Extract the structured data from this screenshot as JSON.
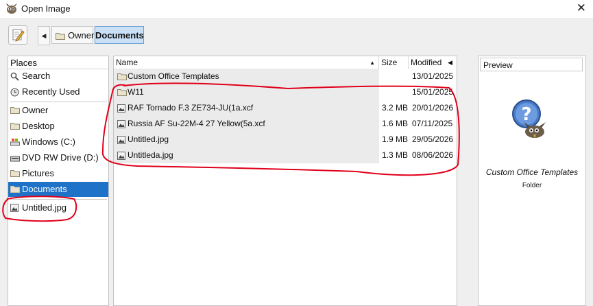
{
  "window": {
    "title": "Open Image",
    "close_glyph": "✕"
  },
  "toolbar": {
    "nav_back_glyph": "◀",
    "breadcrumbs": [
      {
        "label": "Owner"
      },
      {
        "label": "Documents"
      }
    ]
  },
  "places": {
    "header": "Places",
    "items": [
      {
        "label": "Search",
        "icon": "search-icon"
      },
      {
        "label": "Recently Used",
        "icon": "clock-icon"
      },
      {
        "label": "Owner",
        "icon": "folder-icon"
      },
      {
        "label": "Desktop",
        "icon": "folder-icon"
      },
      {
        "label": "Windows (C:)",
        "icon": "drive-icon"
      },
      {
        "label": "DVD RW Drive (D:)",
        "icon": "dvd-icon"
      },
      {
        "label": "Pictures",
        "icon": "folder-icon"
      },
      {
        "label": "Documents",
        "icon": "folder-icon"
      }
    ],
    "bookmarks": [
      {
        "label": "Untitled.jpg",
        "icon": "image-file-icon"
      }
    ]
  },
  "files": {
    "columns": {
      "name": "Name",
      "size": "Size",
      "modified": "Modified"
    },
    "rows": [
      {
        "name": "Custom Office Templates",
        "size": "",
        "modified": "13/01/2025",
        "type": "folder"
      },
      {
        "name": "W11",
        "size": "",
        "modified": "15/01/2025",
        "type": "folder"
      },
      {
        "name": "RAF Tornado F.3 ZE734-JU(1a.xcf",
        "size": "3.2 MB",
        "modified": "20/01/2026",
        "type": "image"
      },
      {
        "name": "Russia AF Su-22M-4 27 Yellow(5a.xcf",
        "size": "1.6 MB",
        "modified": "07/11/2025",
        "type": "image"
      },
      {
        "name": "Untitled.jpg",
        "size": "1.9 MB",
        "modified": "29/05/2026",
        "type": "image"
      },
      {
        "name": "Untitleda.jpg",
        "size": "1.3 MB",
        "modified": "08/06/2026",
        "type": "image"
      }
    ]
  },
  "preview": {
    "label": "Preview",
    "name": "Custom Office Templates",
    "kind": "Folder",
    "icon": "unknown-file-icon"
  },
  "annotation_color": "#e0001b"
}
